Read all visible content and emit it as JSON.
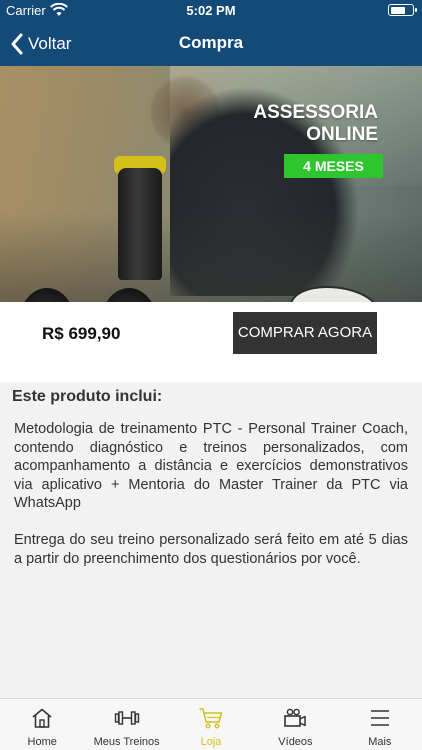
{
  "status": {
    "carrier": "Carrier",
    "time": "5:02 PM"
  },
  "nav": {
    "back_label": "Voltar",
    "title": "Compra"
  },
  "hero": {
    "title_line1": "ASSESSORIA",
    "title_line2": "ONLINE",
    "badge": "4 MESES"
  },
  "product": {
    "price": "R$ 699,90",
    "buy_label": "COMPRAR AGORA"
  },
  "content": {
    "includes_title": "Este produto inclui:",
    "paragraph1": "Metodologia de treinamento PTC - Personal Trainer Coach, contendo diagnóstico e treinos personalizados, com acompanhamento a distância e exercícios demonstrativos via aplicativo + Mentoria do Master Trainer da PTC via WhatsApp",
    "paragraph2": "Entrega do seu treino personalizado será feito em até 5 dias a partir do preenchimento dos questionários por você."
  },
  "tabs": [
    {
      "label": "Home",
      "icon": "home-icon"
    },
    {
      "label": "Meus Treinos",
      "icon": "dumbbell-icon"
    },
    {
      "label": "Loja",
      "icon": "cart-icon",
      "active": true
    },
    {
      "label": "Vídeos",
      "icon": "video-camera-icon"
    },
    {
      "label": "Mais",
      "icon": "menu-icon"
    }
  ],
  "colors": {
    "navbar": "#134a78",
    "badge": "#2fc52f",
    "active_tab": "#d1c21e",
    "buy_button": "#333333"
  }
}
